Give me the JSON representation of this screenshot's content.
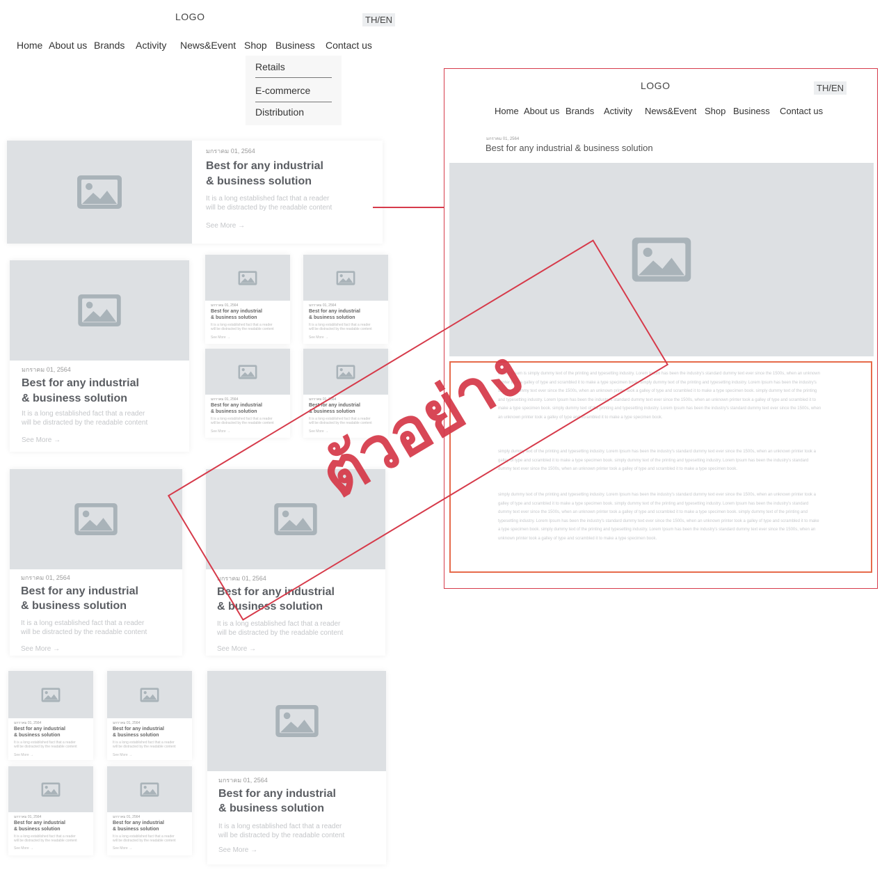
{
  "header": {
    "logo": "LOGO",
    "lang": "TH/EN",
    "nav": [
      "Home",
      "About us",
      "Brands",
      "Activity",
      "News&Event",
      "Shop",
      "Business",
      "Contact us"
    ],
    "business_submenu": [
      "Retails",
      "E-commerce",
      "Distribution"
    ]
  },
  "card": {
    "date": "มกราคม 01, 2564",
    "title_line1": "Best for any industrial",
    "title_line2": "& business solution",
    "desc_line1": "It is a long established fact that a reader",
    "desc_line2": "will be distracted by the readable content",
    "see_more": "See More →"
  },
  "detail": {
    "logo": "LOGO",
    "lang": "TH/EN",
    "nav": [
      "Home",
      "About us",
      "Brands",
      "Activity",
      "News&Event",
      "Shop",
      "Business",
      "Contact us"
    ],
    "date": "มกราคม 01, 2564",
    "title": "Best for any industrial & business solution",
    "paragraph1": "Lorem Ipsum is simply dummy text of the printing and typesetting industry. Lorem Ipsum has been the industry's standard dummy text ever since the 1500s, when an unknown printer took a galley of type and scrambled it to make a type specimen book. simply dummy text of the printing and typesetting industry. Lorem Ipsum has been the industry's standard dummy text ever since the 1500s, when an unknown printer took a galley of type and scrambled it to make a type specimen book. simply dummy text of the printing and typesetting industry. Lorem Ipsum has been the industry's standard dummy text ever since the 1500s, when an unknown printer took a galley of type and scrambled it to make a type specimen book. simply dummy text of the printing and typesetting industry. Lorem Ipsum has been the industry's standard dummy text ever since the 1500s, when an unknown printer took a galley of type and scrambled it to make a type specimen book.",
    "paragraph2": "simply dummy text of the printing and typesetting industry. Lorem Ipsum has been the industry's standard dummy text ever since the 1500s, when an unknown printer took a galley of type and scrambled it to make a type specimen book. simply dummy text of the printing and typesetting industry. Lorem Ipsum has been the industry's standard dummy text ever since the 1500s, when an unknown printer took a galley of type and scrambled it to make a type specimen book.",
    "paragraph3": "simply dummy text of the printing and typesetting industry. Lorem Ipsum has been the industry's standard dummy text ever since the 1500s, when an unknown printer took a galley of type and scrambled it to make a type specimen book. simply dummy text of the printing and typesetting industry. Lorem Ipsum has been the industry's standard dummy text ever since the 1500s, when an unknown printer took a galley of type and scrambled it to make a type specimen book. simply dummy text of the printing and typesetting industry. Lorem Ipsum has been the industry's standard dummy text ever since the 1500s, when an unknown printer took a galley of type and scrambled it to make a type specimen book. simply dummy text of the printing and typesetting industry. Lorem Ipsum has been the industry's standard dummy text ever since the 1500s, when an unknown printer took a galley of type and scrambled it to make a type specimen book."
  },
  "stamp": {
    "text": "ตัวอย่าง"
  },
  "colors": {
    "stamp_red": "#d63a4a",
    "highlight_orange": "#e66a4a",
    "placeholder_gray": "#dde0e3",
    "icon_gray": "#a9b3b9"
  }
}
